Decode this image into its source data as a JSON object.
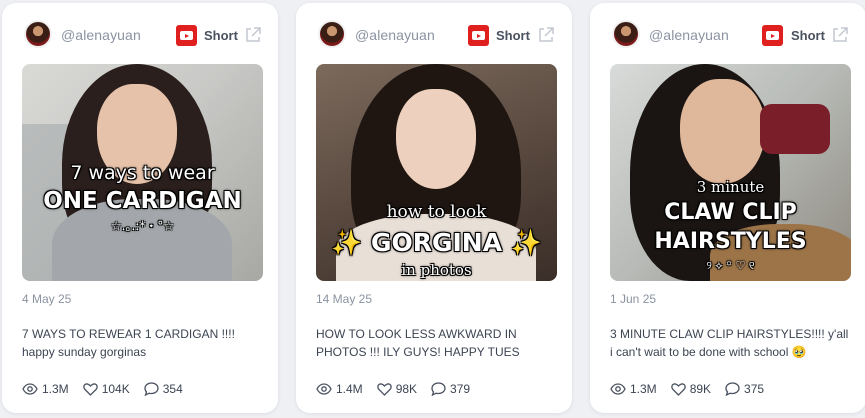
{
  "cards": [
    {
      "handle": "@alenayuan",
      "type_label": "Short",
      "caption": {
        "line1": "7 ways to wear",
        "line2": "ONE CARDIGAN",
        "line3": "☆.｡.:*・°☆"
      },
      "date": "4 May 25",
      "description": "7 WAYS TO REWEAR 1 CARDIGAN !!!! happy sunday gorginas",
      "views": "1.3M",
      "likes": "104K",
      "comments": "354"
    },
    {
      "handle": "@alenayuan",
      "type_label": "Short",
      "caption": {
        "line1": "how to look",
        "line2": "✨ GORGINA ✨",
        "line3": "in photos"
      },
      "date": "14 May 25",
      "description": "HOW TO LOOK LESS AWKWARD IN PHOTOS !!! ILY GUYS! HAPPY TUES",
      "views": "1.4M",
      "likes": "98K",
      "comments": "379"
    },
    {
      "handle": "@alenayuan",
      "type_label": "Short",
      "caption": {
        "line1": "3 minute",
        "line2": "CLAW CLIP",
        "line3": "HAIRSTYLES",
        "line4": "୨ ⟡ ꙳ ♡ ୧"
      },
      "date": "1 Jun 25",
      "description": "3 MINUTE CLAW CLIP HAIRSTYLES!!!! y'all i can't wait to be done with school 🥹",
      "views": "1.3M",
      "likes": "89K",
      "comments": "375"
    }
  ],
  "icons": {
    "platform": "youtube-icon",
    "external": "external-link-icon",
    "views": "eye-icon",
    "likes": "heart-icon",
    "comments": "comment-icon"
  },
  "colors": {
    "youtube_red": "#e0201e",
    "page_bg": "#eef0f4",
    "muted_text": "#8b93a1",
    "body_text": "#3c4452"
  }
}
